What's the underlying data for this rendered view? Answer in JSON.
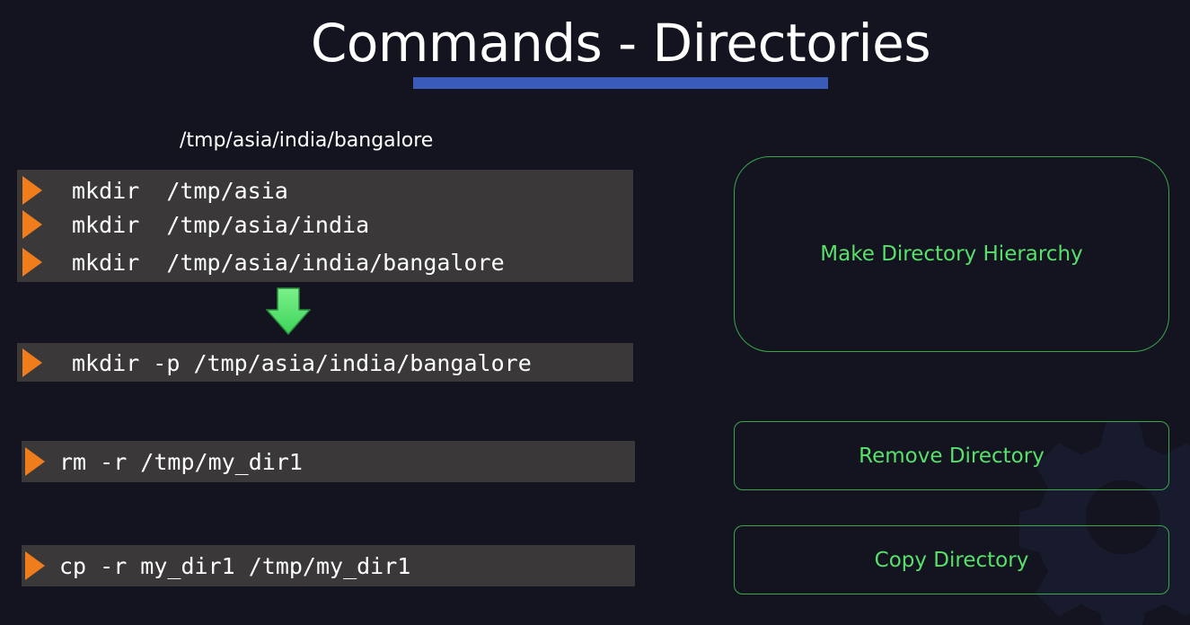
{
  "slide": {
    "title": "Commands - Directories",
    "path_caption": "/tmp/asia/india/bangalore"
  },
  "commands": {
    "mkdir_steps": [
      "mkdir  /tmp/asia",
      "mkdir  /tmp/asia/india",
      "mkdir  /tmp/asia/india/bangalore"
    ],
    "mkdir_p": "mkdir -p /tmp/asia/india/bangalore",
    "rm_r": "rm -r /tmp/my_dir1",
    "cp_r": "cp -r my_dir1 /tmp/my_dir1"
  },
  "labels": {
    "make_hierarchy": "Make Directory Hierarchy",
    "remove_directory": "Remove Directory",
    "copy_directory": "Copy Directory"
  },
  "icons": {
    "bullet": "orange-triangle-arrow-icon",
    "transition": "green-down-arrow-icon",
    "background": "gear-icon"
  },
  "colors": {
    "background": "#131420",
    "title_underline": "#3b5bb8",
    "command_box": "#3a3838",
    "bullet_arrow": "#f07d1c",
    "label_text": "#57e06a",
    "label_border": "#3aa84a",
    "down_arrow": "#5cf06a"
  }
}
